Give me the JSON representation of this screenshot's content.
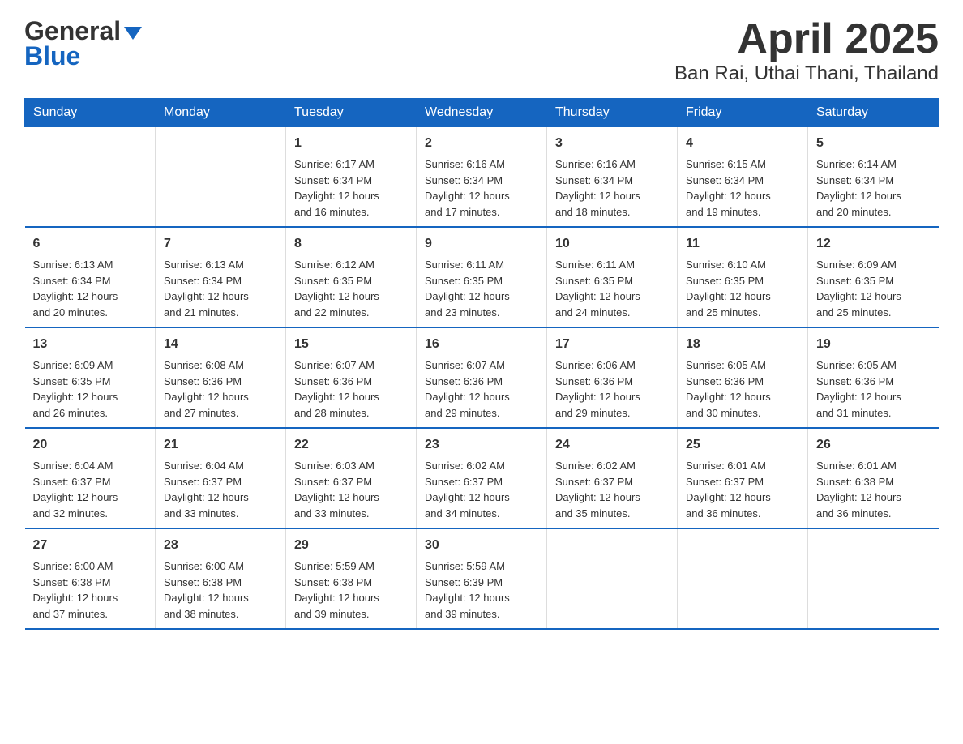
{
  "header": {
    "logo_line1": "General",
    "logo_line2": "Blue",
    "title": "April 2025",
    "subtitle": "Ban Rai, Uthai Thani, Thailand"
  },
  "calendar": {
    "days_of_week": [
      "Sunday",
      "Monday",
      "Tuesday",
      "Wednesday",
      "Thursday",
      "Friday",
      "Saturday"
    ],
    "weeks": [
      [
        {
          "day": "",
          "info": ""
        },
        {
          "day": "",
          "info": ""
        },
        {
          "day": "1",
          "info": "Sunrise: 6:17 AM\nSunset: 6:34 PM\nDaylight: 12 hours\nand 16 minutes."
        },
        {
          "day": "2",
          "info": "Sunrise: 6:16 AM\nSunset: 6:34 PM\nDaylight: 12 hours\nand 17 minutes."
        },
        {
          "day": "3",
          "info": "Sunrise: 6:16 AM\nSunset: 6:34 PM\nDaylight: 12 hours\nand 18 minutes."
        },
        {
          "day": "4",
          "info": "Sunrise: 6:15 AM\nSunset: 6:34 PM\nDaylight: 12 hours\nand 19 minutes."
        },
        {
          "day": "5",
          "info": "Sunrise: 6:14 AM\nSunset: 6:34 PM\nDaylight: 12 hours\nand 20 minutes."
        }
      ],
      [
        {
          "day": "6",
          "info": "Sunrise: 6:13 AM\nSunset: 6:34 PM\nDaylight: 12 hours\nand 20 minutes."
        },
        {
          "day": "7",
          "info": "Sunrise: 6:13 AM\nSunset: 6:34 PM\nDaylight: 12 hours\nand 21 minutes."
        },
        {
          "day": "8",
          "info": "Sunrise: 6:12 AM\nSunset: 6:35 PM\nDaylight: 12 hours\nand 22 minutes."
        },
        {
          "day": "9",
          "info": "Sunrise: 6:11 AM\nSunset: 6:35 PM\nDaylight: 12 hours\nand 23 minutes."
        },
        {
          "day": "10",
          "info": "Sunrise: 6:11 AM\nSunset: 6:35 PM\nDaylight: 12 hours\nand 24 minutes."
        },
        {
          "day": "11",
          "info": "Sunrise: 6:10 AM\nSunset: 6:35 PM\nDaylight: 12 hours\nand 25 minutes."
        },
        {
          "day": "12",
          "info": "Sunrise: 6:09 AM\nSunset: 6:35 PM\nDaylight: 12 hours\nand 25 minutes."
        }
      ],
      [
        {
          "day": "13",
          "info": "Sunrise: 6:09 AM\nSunset: 6:35 PM\nDaylight: 12 hours\nand 26 minutes."
        },
        {
          "day": "14",
          "info": "Sunrise: 6:08 AM\nSunset: 6:36 PM\nDaylight: 12 hours\nand 27 minutes."
        },
        {
          "day": "15",
          "info": "Sunrise: 6:07 AM\nSunset: 6:36 PM\nDaylight: 12 hours\nand 28 minutes."
        },
        {
          "day": "16",
          "info": "Sunrise: 6:07 AM\nSunset: 6:36 PM\nDaylight: 12 hours\nand 29 minutes."
        },
        {
          "day": "17",
          "info": "Sunrise: 6:06 AM\nSunset: 6:36 PM\nDaylight: 12 hours\nand 29 minutes."
        },
        {
          "day": "18",
          "info": "Sunrise: 6:05 AM\nSunset: 6:36 PM\nDaylight: 12 hours\nand 30 minutes."
        },
        {
          "day": "19",
          "info": "Sunrise: 6:05 AM\nSunset: 6:36 PM\nDaylight: 12 hours\nand 31 minutes."
        }
      ],
      [
        {
          "day": "20",
          "info": "Sunrise: 6:04 AM\nSunset: 6:37 PM\nDaylight: 12 hours\nand 32 minutes."
        },
        {
          "day": "21",
          "info": "Sunrise: 6:04 AM\nSunset: 6:37 PM\nDaylight: 12 hours\nand 33 minutes."
        },
        {
          "day": "22",
          "info": "Sunrise: 6:03 AM\nSunset: 6:37 PM\nDaylight: 12 hours\nand 33 minutes."
        },
        {
          "day": "23",
          "info": "Sunrise: 6:02 AM\nSunset: 6:37 PM\nDaylight: 12 hours\nand 34 minutes."
        },
        {
          "day": "24",
          "info": "Sunrise: 6:02 AM\nSunset: 6:37 PM\nDaylight: 12 hours\nand 35 minutes."
        },
        {
          "day": "25",
          "info": "Sunrise: 6:01 AM\nSunset: 6:37 PM\nDaylight: 12 hours\nand 36 minutes."
        },
        {
          "day": "26",
          "info": "Sunrise: 6:01 AM\nSunset: 6:38 PM\nDaylight: 12 hours\nand 36 minutes."
        }
      ],
      [
        {
          "day": "27",
          "info": "Sunrise: 6:00 AM\nSunset: 6:38 PM\nDaylight: 12 hours\nand 37 minutes."
        },
        {
          "day": "28",
          "info": "Sunrise: 6:00 AM\nSunset: 6:38 PM\nDaylight: 12 hours\nand 38 minutes."
        },
        {
          "day": "29",
          "info": "Sunrise: 5:59 AM\nSunset: 6:38 PM\nDaylight: 12 hours\nand 39 minutes."
        },
        {
          "day": "30",
          "info": "Sunrise: 5:59 AM\nSunset: 6:39 PM\nDaylight: 12 hours\nand 39 minutes."
        },
        {
          "day": "",
          "info": ""
        },
        {
          "day": "",
          "info": ""
        },
        {
          "day": "",
          "info": ""
        }
      ]
    ]
  }
}
